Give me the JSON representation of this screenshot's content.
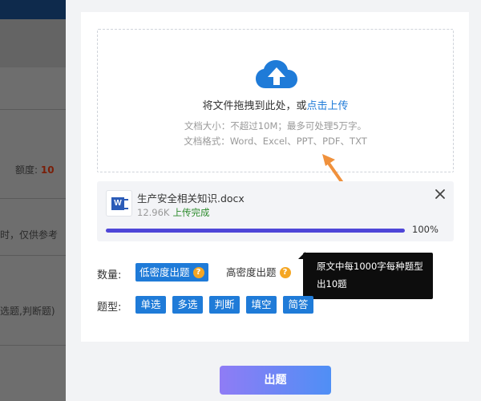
{
  "background": {
    "quota_label": "额度: ",
    "quota_value": "10",
    "note_text": "时，仅供参考",
    "types_text": "选题,判断题)"
  },
  "upload": {
    "drop_text": "将文件拖拽到此处，或",
    "upload_link": "点击上传",
    "size_hint": "文档大小：不超过10M；最多可处理5万字。",
    "format_hint": "文档格式：Word、Excel、PPT、PDF、TXT"
  },
  "file": {
    "name": "生产安全相关知识.docx",
    "size": "12.96K",
    "status": "上传完成",
    "progress_label": "100%",
    "progress": 1.0
  },
  "options": {
    "quantity_label": "数量:",
    "low_density": "低密度出题",
    "high_density": "高密度出题",
    "tooltip": "原文中每1000字每种题型出10题",
    "type_label": "题型:",
    "types": [
      "单选",
      "多选",
      "判断",
      "填空",
      "简答"
    ]
  },
  "submit_label": "出题",
  "colors": {
    "accent": "#1f7bd8",
    "progress": "#4f46d8",
    "success": "#2c8a2c",
    "badge": "#f5a623",
    "arrow": "#f0913c"
  }
}
